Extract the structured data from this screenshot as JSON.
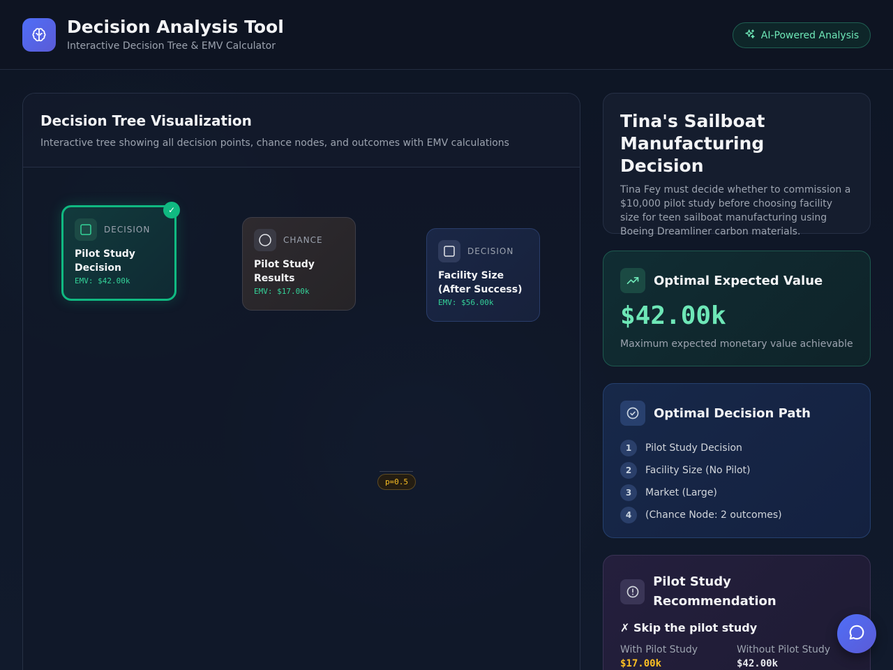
{
  "header": {
    "title": "Decision Analysis Tool",
    "subtitle": "Interactive Decision Tree & EMV Calculator",
    "badge": "AI-Powered Analysis"
  },
  "tree": {
    "title": "Decision Tree Visualization",
    "description": "Interactive tree showing all decision points, chance nodes, and outcomes with EMV calculations",
    "nodes": [
      {
        "type": "DECISION",
        "label": "Pilot Study Decision",
        "emv": "EMV: $42.00k",
        "selected": true
      },
      {
        "type": "CHANCE",
        "label": "Pilot Study Results",
        "emv": "EMV: $17.00k"
      },
      {
        "type": "DECISION",
        "label": "Facility Size (After Success)",
        "emv": "EMV: $56.00k"
      }
    ],
    "probability": "p=0.5",
    "check": "✓"
  },
  "scenario": {
    "title": "Tina's Sailboat Manufacturing Decision",
    "description": "Tina Fey must decide whether to commission a $10,000 pilot study before choosing facility size for teen sailboat manufacturing using Boeing Dreamliner carbon materials."
  },
  "optimal_value": {
    "title": "Optimal Expected Value",
    "value": "$42.00k",
    "note": "Maximum expected monetary value achievable",
    "icon": "trending-up-icon"
  },
  "optimal_path": {
    "title": "Optimal Decision Path",
    "steps": [
      {
        "num": "1",
        "label": "Pilot Study Decision"
      },
      {
        "num": "2",
        "label": "Facility Size (No Pilot)"
      },
      {
        "num": "3",
        "label": "Market (Large)"
      },
      {
        "num": "4",
        "label": "(Chance Node: 2 outcomes)"
      }
    ]
  },
  "pilot_recommendation": {
    "title": "Pilot Study Recommendation",
    "recommendation": "✗ Skip the pilot study",
    "with_label": "With Pilot Study",
    "with_value": "$17.00k",
    "without_label": "Without Pilot Study",
    "without_value": "$42.00k"
  },
  "colors": {
    "accent": "#10b981",
    "brand": "#4f6ef7",
    "probability": "#fbbf24"
  }
}
